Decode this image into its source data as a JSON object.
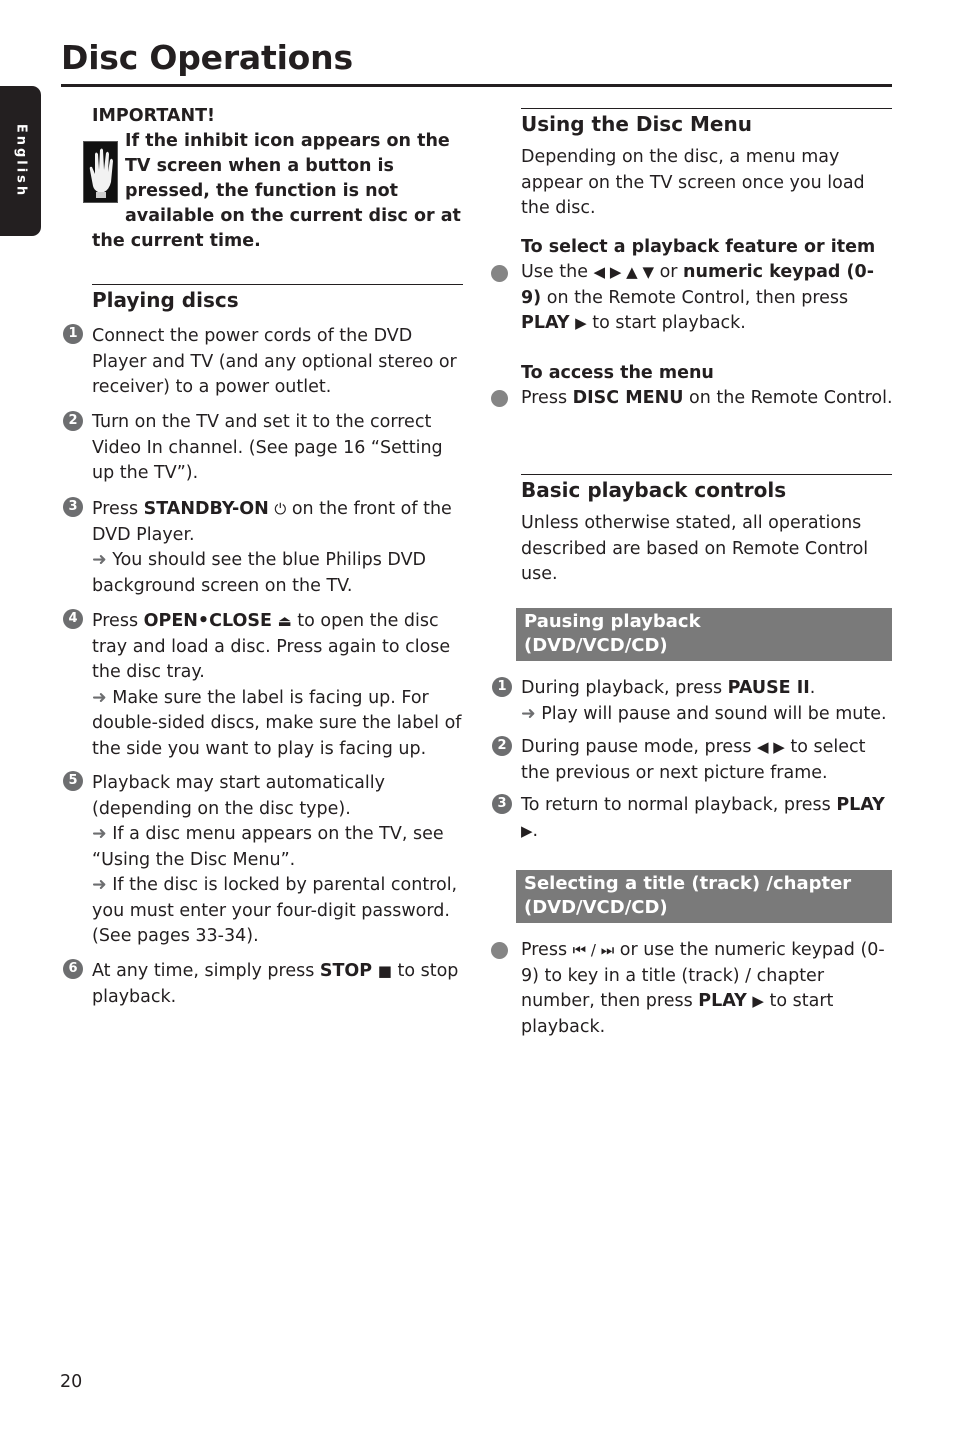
{
  "page": {
    "title": "Disc Operations",
    "language_tab": "English",
    "page_number": "20"
  },
  "important": {
    "heading": "IMPORTANT!",
    "lines": [
      "If the inhibit icon appears on the",
      "TV screen when a button is",
      "pressed, the function is not",
      "available on the current disc or at",
      "the current time."
    ]
  },
  "playing_discs": {
    "heading": "Playing discs",
    "steps": [
      {
        "num": "1",
        "parts": {
          "a": "Connect the power cords of the DVD Player and TV (and any optional stereo or receiver) to a power outlet."
        }
      },
      {
        "num": "2",
        "parts": {
          "a": "Turn on the TV and set it to the correct Video In channel.  (See page 16 “Setting up the TV”)."
        }
      },
      {
        "num": "3",
        "parts": {
          "a": "Press ",
          "b": "STANDBY-ON",
          "sym": "⏻",
          "c": " on the front of the DVD Player.",
          "arrow": "➜",
          "note": " You should see the blue Philips DVD background screen on the TV."
        }
      },
      {
        "num": "4",
        "parts": {
          "a": "Press ",
          "b": "OPEN•CLOSE",
          "sym": "⏏",
          "c": " to open the disc tray and load a disc. Press again to close the disc tray.",
          "arrow": "➜",
          "note": " Make sure the label is facing up.  For double-sided discs, make sure the label of the side you want to play is facing up."
        }
      },
      {
        "num": "5",
        "parts": {
          "a": "Playback may start automatically (depending on the disc type).",
          "arrow": "➜",
          "note": " If a disc menu appears on the TV, see “Using the Disc Menu”.",
          "arrow2": "➜",
          "note2": " If the disc is locked by parental control, you must enter your four-digit password. (See pages 33-34)."
        }
      },
      {
        "num": "6",
        "parts": {
          "a": "At any time, simply press ",
          "b": "STOP",
          "sym": "■",
          "c": " to stop playback."
        }
      }
    ]
  },
  "disc_menu": {
    "heading": "Using the Disc Menu",
    "intro": "Depending on the disc, a menu may appear on the TV screen once you load the disc.",
    "select": {
      "subheading": "To select a playback feature or item",
      "a": "Use the ",
      "sym": "◀ ▶ ▲ ▼",
      "b": " or ",
      "c": "numeric keypad (0-9)",
      "d": " on the Remote Control, then press ",
      "e": "PLAY",
      "sym2": "▶",
      "f": " to start playback."
    },
    "access": {
      "subheading": "To access the menu",
      "a": "Press ",
      "b": "DISC MENU",
      "c": " on the Remote Control."
    }
  },
  "basic_controls": {
    "heading": "Basic playback controls",
    "intro": "Unless otherwise stated, all operations described are based on Remote Control use."
  },
  "pausing": {
    "bar_line1": "Pausing playback",
    "bar_line2": "(DVD/VCD/CD)",
    "steps": [
      {
        "num": "1",
        "a": "During playback, press ",
        "b": "PAUSE II",
        "c": ".",
        "arrow": "➜",
        "note": " Play will pause and sound will be mute."
      },
      {
        "num": "2",
        "a": "During pause mode, press ",
        "sym": "◀ ▶",
        "c": " to select the previous or next picture frame."
      },
      {
        "num": "3",
        "a": "To return to normal playback, press ",
        "b": "PLAY",
        "sym": "▶",
        "c": "."
      }
    ]
  },
  "selecting": {
    "bar_line1": "Selecting a title (track) /chapter",
    "bar_line2": "(DVD/VCD/CD)",
    "a": "Press ",
    "sym": "⏮ / ⏭",
    "b": " or use the numeric keypad (0-9) to key in a title (track) / chapter number, then press ",
    "c": "PLAY",
    "sym2": "▶",
    "d": " to start playback."
  }
}
